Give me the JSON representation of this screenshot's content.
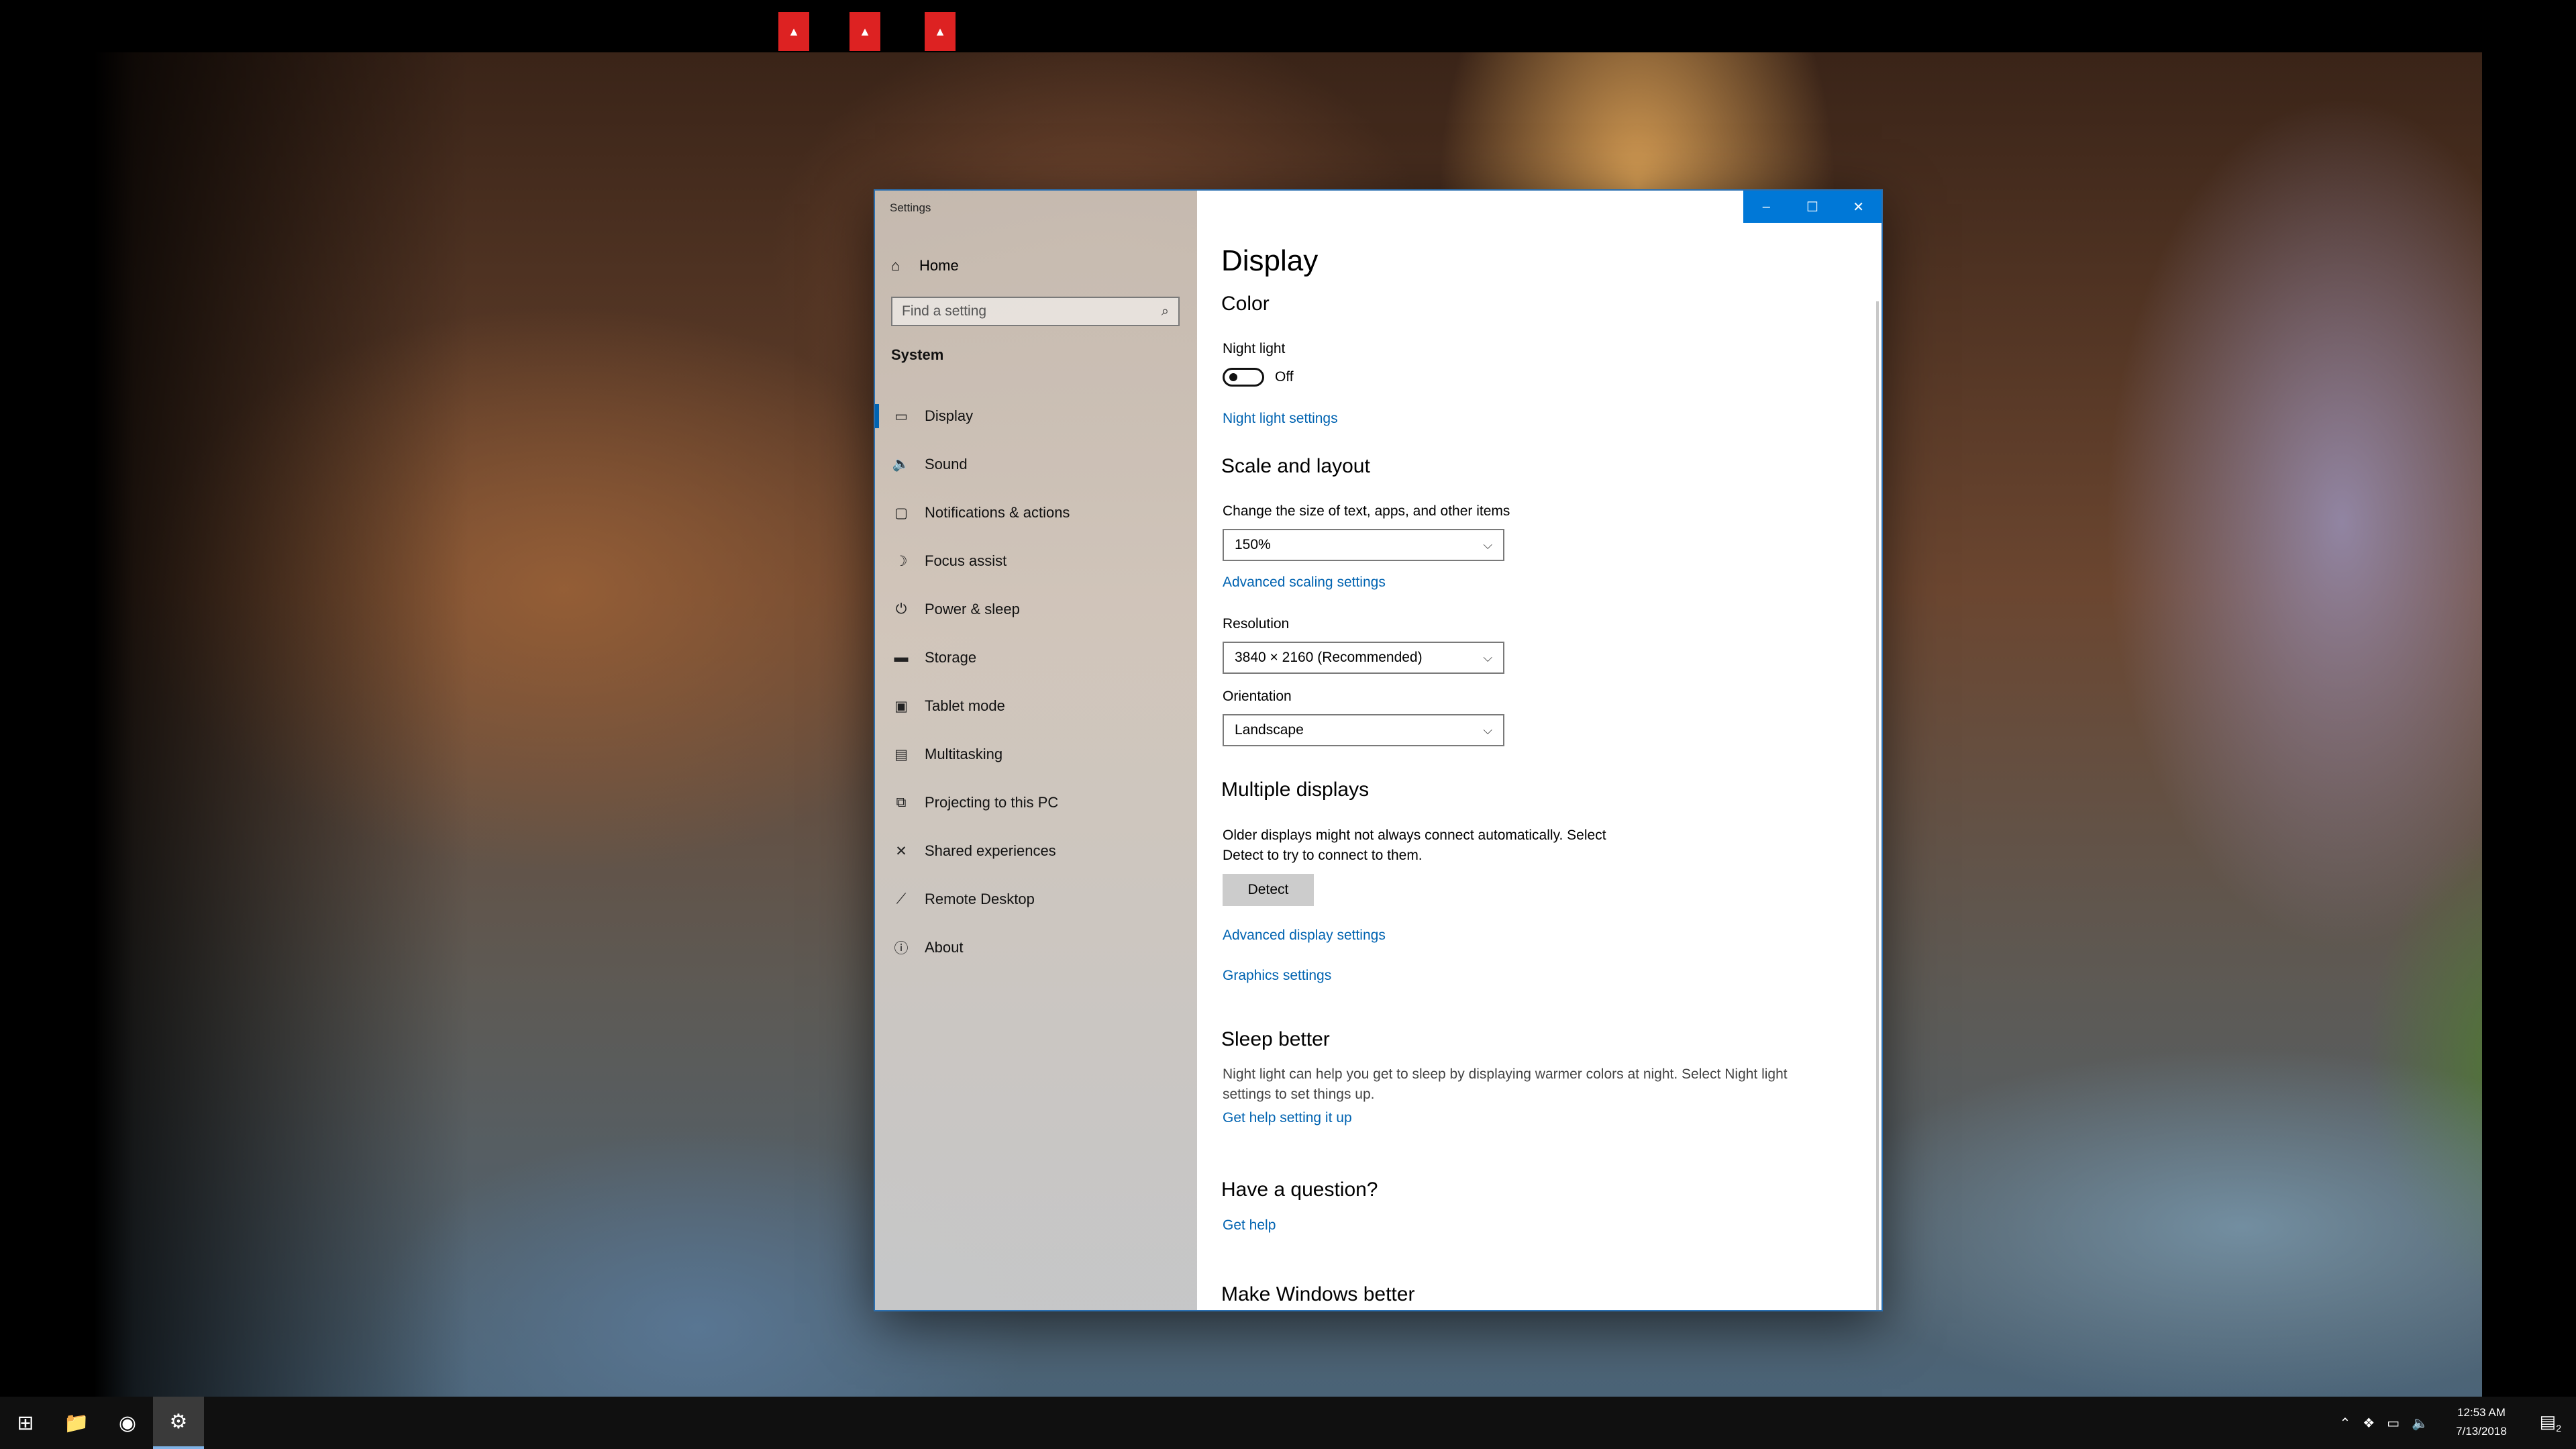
{
  "window": {
    "title": "Settings",
    "caption": {
      "minimize": "–",
      "maximize": "☐",
      "close": "✕"
    }
  },
  "sidebar": {
    "home_label": "Home",
    "search_placeholder": "Find a setting",
    "section_label": "System",
    "items": [
      {
        "label": "Display",
        "icon": "display-icon",
        "glyph": "▭",
        "selected": true
      },
      {
        "label": "Sound",
        "icon": "speaker-icon",
        "glyph": "🔈"
      },
      {
        "label": "Notifications & actions",
        "icon": "notification-icon",
        "glyph": "▢"
      },
      {
        "label": "Focus assist",
        "icon": "moon-icon",
        "glyph": "☽"
      },
      {
        "label": "Power & sleep",
        "icon": "power-icon",
        "glyph": "⏻"
      },
      {
        "label": "Storage",
        "icon": "storage-icon",
        "glyph": "▬"
      },
      {
        "label": "Tablet mode",
        "icon": "tablet-icon",
        "glyph": "▣"
      },
      {
        "label": "Multitasking",
        "icon": "multitasking-icon",
        "glyph": "▤"
      },
      {
        "label": "Projecting to this PC",
        "icon": "projector-icon",
        "glyph": "⧉"
      },
      {
        "label": "Shared experiences",
        "icon": "shared-icon",
        "glyph": "✕"
      },
      {
        "label": "Remote Desktop",
        "icon": "remote-icon",
        "glyph": "⟋"
      },
      {
        "label": "About",
        "icon": "info-icon",
        "glyph": "ⓘ"
      }
    ]
  },
  "content": {
    "page_title": "Display",
    "color_heading": "Color",
    "night_light_label": "Night light",
    "night_light_state": "Off",
    "night_light_settings_link": "Night light settings",
    "scale_heading": "Scale and layout",
    "scale_label": "Change the size of text, apps, and other items",
    "scale_value": "150%",
    "advanced_scaling_link": "Advanced scaling settings",
    "resolution_label": "Resolution",
    "resolution_value": "3840 × 2160 (Recommended)",
    "orientation_label": "Orientation",
    "orientation_value": "Landscape",
    "multiple_heading": "Multiple displays",
    "multiple_desc_1": "Older displays might not always connect automatically. Select",
    "multiple_desc_2": "Detect to try to connect to them.",
    "detect_button": "Detect",
    "advanced_display_link": "Advanced display settings",
    "graphics_link": "Graphics settings",
    "sleep_heading": "Sleep better",
    "sleep_desc_1": "Night light can help you get to sleep by displaying warmer colors at night. Select Night light",
    "sleep_desc_2": "settings to set things up.",
    "sleep_help_link": "Get help setting it up",
    "question_heading": "Have a question?",
    "get_help_link": "Get help",
    "windows_better_heading": "Make Windows better"
  },
  "taskbar": {
    "items": [
      {
        "icon": "start-icon",
        "glyph": "⊞"
      },
      {
        "icon": "file-explorer-icon",
        "glyph": "📁"
      },
      {
        "icon": "chrome-icon",
        "glyph": "◉"
      },
      {
        "icon": "settings-gear-icon",
        "glyph": "⚙",
        "active": true
      }
    ],
    "time": "12:53 AM",
    "date": "7/13/2018",
    "notification_count": "2"
  },
  "colors": {
    "accent": "#0078d7",
    "link": "#0063b1"
  }
}
